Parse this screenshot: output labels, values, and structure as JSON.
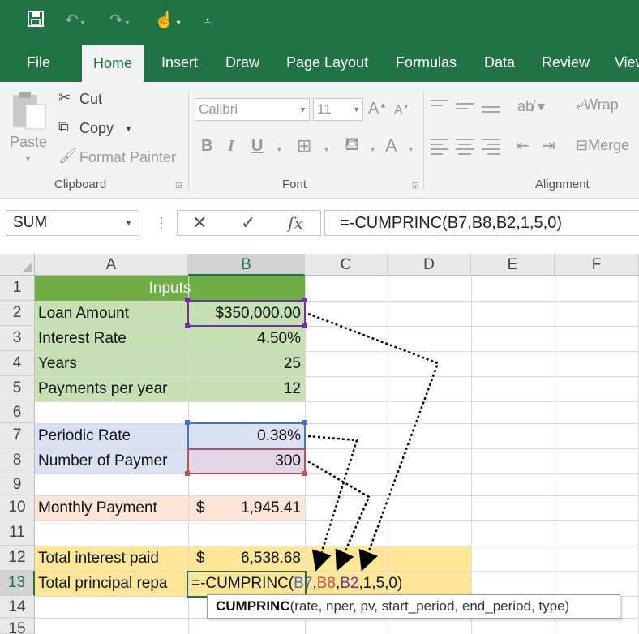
{
  "qat": {
    "save_icon": "save-icon",
    "undo_icon": "undo-icon",
    "redo_icon": "redo-icon",
    "touch_icon": "touch-mode-icon",
    "customize_icon": "customize-qat-icon"
  },
  "tabs": [
    "File",
    "Home",
    "Insert",
    "Draw",
    "Page Layout",
    "Formulas",
    "Data",
    "Review",
    "View"
  ],
  "active_tab": "Home",
  "ribbon": {
    "clipboard": {
      "paste": "Paste",
      "cut": "Cut",
      "copy": "Copy",
      "format_painter": "Format Painter",
      "label": "Clipboard"
    },
    "font": {
      "font_name": "Calibri",
      "font_size": "11",
      "bold": "B",
      "italic": "I",
      "underline": "U",
      "label": "Font"
    },
    "alignment": {
      "wrap": "Wrap",
      "merge": "Merge",
      "label": "Alignment"
    }
  },
  "formula_bar": {
    "name_box": "SUM",
    "formula": "=-CUMPRINC(B7,B8,B2,1,5,0)",
    "fx": "fx"
  },
  "columns": [
    "A",
    "B",
    "C",
    "D",
    "E",
    "F"
  ],
  "rows": [
    "1",
    "2",
    "3",
    "4",
    "5",
    "6",
    "7",
    "8",
    "9",
    "10",
    "11",
    "12",
    "13",
    "14",
    "15"
  ],
  "cells": {
    "A1": "Inputs",
    "A2": "Loan Amount",
    "B2": "$350,000.00",
    "A3": "Interest Rate",
    "B3": "4.50%",
    "A4": "Years",
    "B4": "25",
    "A5": "Payments per year",
    "B5": "12",
    "A7": "Periodic Rate",
    "B7": "0.38%",
    "A8": "Number of Paymer",
    "B8": "300",
    "A10": "Monthly Payment",
    "B10_symbol": "$",
    "B10": "1,945.41",
    "A12": "Total interest paid",
    "B12_symbol": "$",
    "B12": "6,538.68",
    "A13": "Total principal repa",
    "B13_prefix": "=-CUMPRINC(",
    "B13_ref1": "B7",
    "B13_ref2": "B8",
    "B13_ref3": "B2",
    "B13_suffix": ",1,5,0)",
    "comma": ","
  },
  "tooltip": {
    "function": "CUMPRINC",
    "args": "(rate, nper, pv, start_period, end_period, type)"
  },
  "colors": {
    "excel_green": "#217346",
    "inputs_header": "#70ad47",
    "inputs_fill": "#c6e0b4",
    "calc_fill": "#d9e1f2",
    "payment_fill": "#fce4d6",
    "result_fill": "#ffe699",
    "ref_blue": "#4472c4",
    "ref_red": "#c0504d",
    "ref_purple": "#7030a0"
  }
}
